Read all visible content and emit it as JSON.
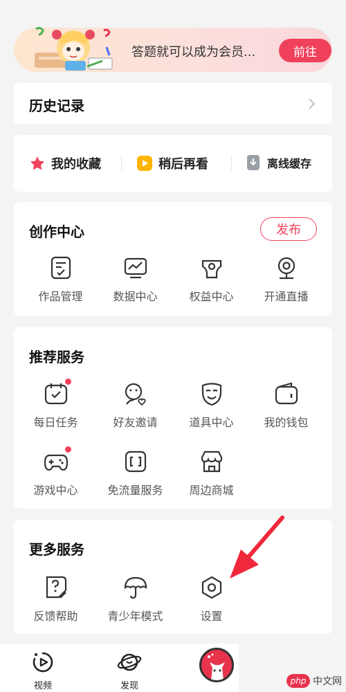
{
  "banner": {
    "text": "答题就可以成为会员...",
    "go_label": "前往"
  },
  "history": {
    "title": "历史记录"
  },
  "quick": {
    "items": [
      {
        "label": "我的收藏",
        "icon": "star-icon"
      },
      {
        "label": "稍后再看",
        "icon": "play-later-icon"
      },
      {
        "label": "离线缓存",
        "icon": "download-icon"
      }
    ]
  },
  "creation": {
    "title": "创作中心",
    "publish_label": "发布",
    "items": [
      {
        "label": "作品管理",
        "icon": "works-icon"
      },
      {
        "label": "数据中心",
        "icon": "chart-icon"
      },
      {
        "label": "权益中心",
        "icon": "benefits-icon"
      },
      {
        "label": "开通直播",
        "icon": "camera-icon"
      }
    ]
  },
  "recommended": {
    "title": "推荐服务",
    "items": [
      {
        "label": "每日任务",
        "icon": "calendar-check-icon",
        "dot": true
      },
      {
        "label": "好友邀请",
        "icon": "invite-friend-icon",
        "dot": false
      },
      {
        "label": "道具中心",
        "icon": "mask-icon",
        "dot": false
      },
      {
        "label": "我的钱包",
        "icon": "wallet-icon",
        "dot": false
      },
      {
        "label": "游戏中心",
        "icon": "gamepad-icon",
        "dot": true
      },
      {
        "label": "免流量服务",
        "icon": "sim-icon",
        "dot": false
      },
      {
        "label": "周边商城",
        "icon": "store-icon",
        "dot": false
      }
    ]
  },
  "more": {
    "title": "更多服务",
    "items": [
      {
        "label": "反馈帮助",
        "icon": "feedback-icon"
      },
      {
        "label": "青少年模式",
        "icon": "umbrella-icon"
      },
      {
        "label": "设置",
        "icon": "settings-hexagon-icon"
      }
    ]
  },
  "tabbar": {
    "tabs": [
      {
        "label": "视频",
        "icon": "video-icon"
      },
      {
        "label": "发现",
        "icon": "planet-icon"
      }
    ]
  },
  "watermark": {
    "logo": "php",
    "text": "中文网"
  },
  "colors": {
    "accent": "#f0415c",
    "background": "#f4f4f4",
    "annotation_arrow": "#f0283c"
  }
}
